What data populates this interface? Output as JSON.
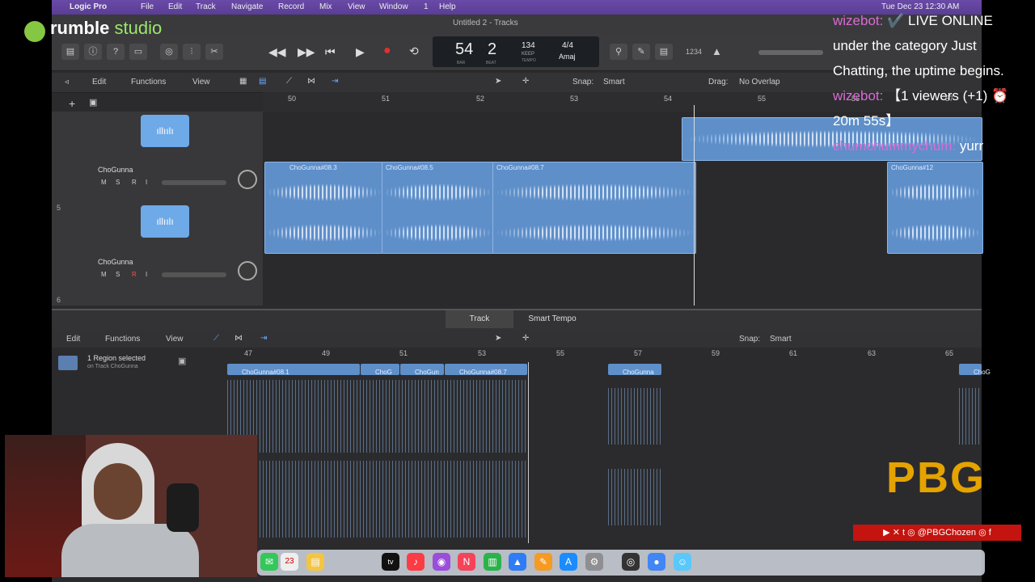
{
  "menubar": {
    "app": "Logic Pro",
    "items": [
      "File",
      "Edit",
      "Track",
      "Navigate",
      "Record",
      "Mix",
      "View",
      "Window",
      "1",
      "Help"
    ],
    "clock": "Tue Dec 23  12:30 AM"
  },
  "window": {
    "title": "Untitled 2 - Tracks"
  },
  "lcd": {
    "bar": "54",
    "beat": "2",
    "bar_label": "BAR",
    "beat_label": "BEAT",
    "tempo": "134",
    "tempo_label": "KEEP",
    "tempo_sub": "TEMPO",
    "sig": "4/4",
    "key": "Amaj"
  },
  "lcd_mini": "1234",
  "toolbar": {
    "edit": "Edit",
    "functions": "Functions",
    "view": "View",
    "snap_label": "Snap:",
    "snap_value": "Smart",
    "drag_label": "Drag:",
    "drag_value": "No Overlap"
  },
  "ruler": [
    "50",
    "51",
    "52",
    "53",
    "54",
    "55",
    "56",
    "57"
  ],
  "tracks": [
    {
      "name": "ChoGunna",
      "m": "M",
      "s": "S",
      "r": "R",
      "i": "I",
      "number": "5"
    },
    {
      "name": "ChoGunna",
      "m": "M",
      "s": "S",
      "r": "R",
      "i": "I",
      "number": "6"
    }
  ],
  "regions": [
    {
      "label": "ChoGunna#08.3"
    },
    {
      "label": "ChoGunna#08.5"
    },
    {
      "label": "ChoGunna#08.7"
    },
    {
      "label": "ChoGunna#12"
    }
  ],
  "tabs": {
    "track": "Track",
    "smart_tempo": "Smart Tempo"
  },
  "editor_toolbar": {
    "edit": "Edit",
    "functions": "Functions",
    "view": "View",
    "snap_label": "Snap:",
    "snap_value": "Smart"
  },
  "selection": {
    "count": "1 Region selected",
    "detail": "on Track ChoGunna"
  },
  "ruler2": [
    "47",
    "49",
    "51",
    "53",
    "55",
    "57",
    "59",
    "61",
    "63",
    "65"
  ],
  "bottom_regions": [
    "ChoGunna#08.1",
    "ChoG",
    "ChoGun",
    "ChoGunna#08.7",
    "ChoGunna",
    "ChoG"
  ],
  "overlay": {
    "brand": "rumble",
    "brand_suffix": "studio",
    "chat": [
      {
        "user": "wizebot:",
        "text": "✔️ LIVE ONLINE under the category Just Chatting, the uptime begins."
      },
      {
        "user": "wizebot:",
        "text": "【1 viewers (+1) ⏰ 20m 55s】"
      },
      {
        "user": "chumchummychum:",
        "text": "yurr"
      }
    ],
    "pbg": "PBG",
    "social": "▶ ✕ t ◎ @PBGChozen ◎ f"
  },
  "dock_icons": [
    "messages-icon",
    "calendar-icon",
    "notes-icon",
    "appletv-icon",
    "music-icon",
    "podcasts-icon",
    "news-icon",
    "numbers-icon",
    "keynote-icon",
    "pages-icon",
    "appstore-icon",
    "settings-icon",
    "logic-icon",
    "chrome-icon",
    "finder-icon"
  ],
  "colors": {
    "region": "#5e8fc9",
    "chat_user": "#d96bd6",
    "pbg": "#e5a300",
    "rumble": "#85c742"
  }
}
